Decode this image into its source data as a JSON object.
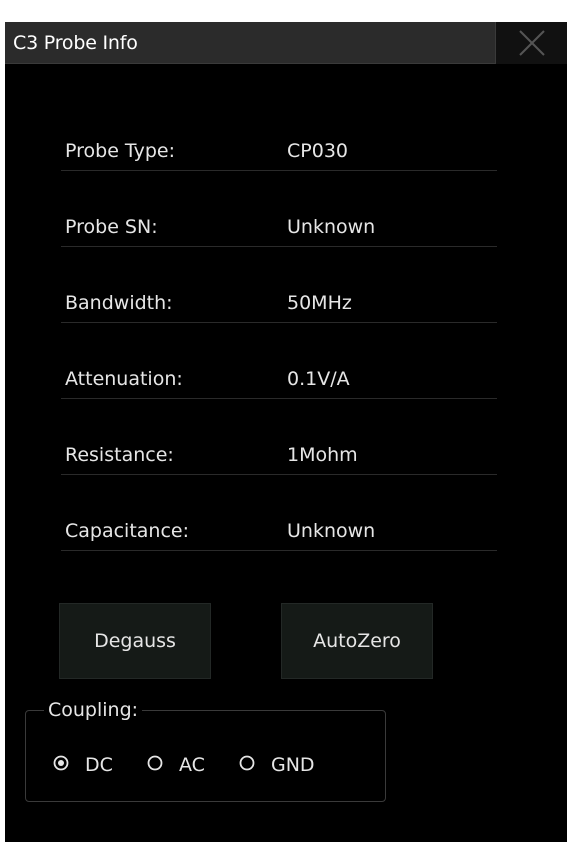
{
  "dialog": {
    "title": "C3 Probe Info",
    "close_icon": "close-icon"
  },
  "info_rows": [
    {
      "label": "Probe Type:",
      "value": "CP030"
    },
    {
      "label": "Probe SN:",
      "value": "Unknown"
    },
    {
      "label": "Bandwidth:",
      "value": "50MHz"
    },
    {
      "label": "Attenuation:",
      "value": "0.1V/A"
    },
    {
      "label": "Resistance:",
      "value": "1Mohm"
    },
    {
      "label": "Capacitance:",
      "value": "Unknown"
    }
  ],
  "buttons": {
    "degauss_label": "Degauss",
    "autozero_label": "AutoZero"
  },
  "coupling": {
    "legend": "Coupling:",
    "options": [
      {
        "label": "DC",
        "selected": true
      },
      {
        "label": "AC",
        "selected": false
      },
      {
        "label": "GND",
        "selected": false
      }
    ]
  },
  "colors": {
    "background": "#000000",
    "titlebar": "#2b2b2b",
    "text": "#e6e6e6",
    "button": "#151a17"
  }
}
